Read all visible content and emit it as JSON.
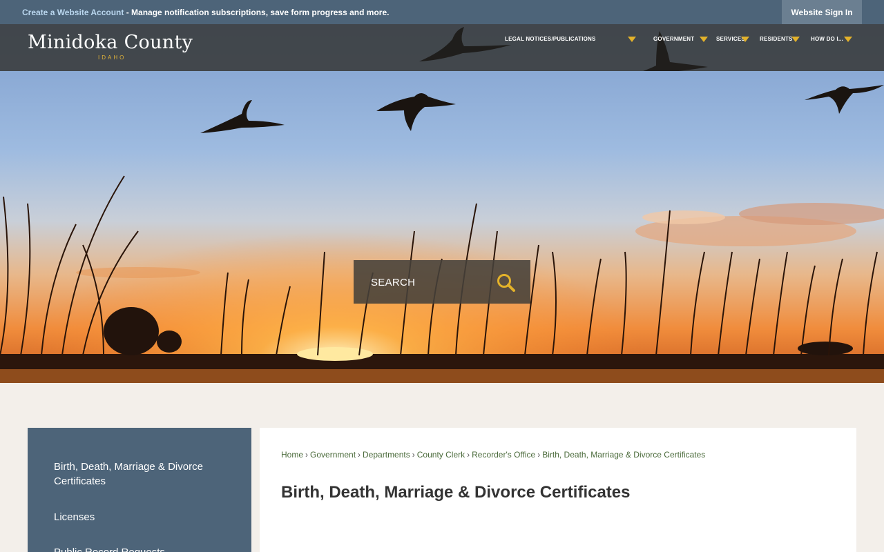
{
  "topbar": {
    "create_link": "Create a Website Account",
    "message": " - Manage notification subscriptions, save form progress and more.",
    "signin": "Website Sign In"
  },
  "logo": {
    "title": "Minidoka County",
    "subtitle": "IDAHO"
  },
  "nav": [
    {
      "label": "LEGAL NOTICES/PUBLICATIONS"
    },
    {
      "label": "GOVERNMENT"
    },
    {
      "label": "SERVICES"
    },
    {
      "label": "RESIDENTS"
    },
    {
      "label": "HOW DO I..."
    }
  ],
  "search": {
    "placeholder": "SEARCH"
  },
  "sidebar": {
    "items": [
      "Birth, Death, Marriage & Divorce Certificates",
      "Licenses",
      "Public Record Requests"
    ]
  },
  "breadcrumb": {
    "items": [
      "Home",
      "Government",
      "Departments",
      "County Clerk",
      "Recorder's Office"
    ],
    "current": "Birth, Death, Marriage & Divorce Certificates"
  },
  "page": {
    "title": "Birth, Death, Marriage & Divorce Certificates"
  },
  "colors": {
    "accent": "#e3b22a",
    "nav_bar": "#4d6479"
  }
}
